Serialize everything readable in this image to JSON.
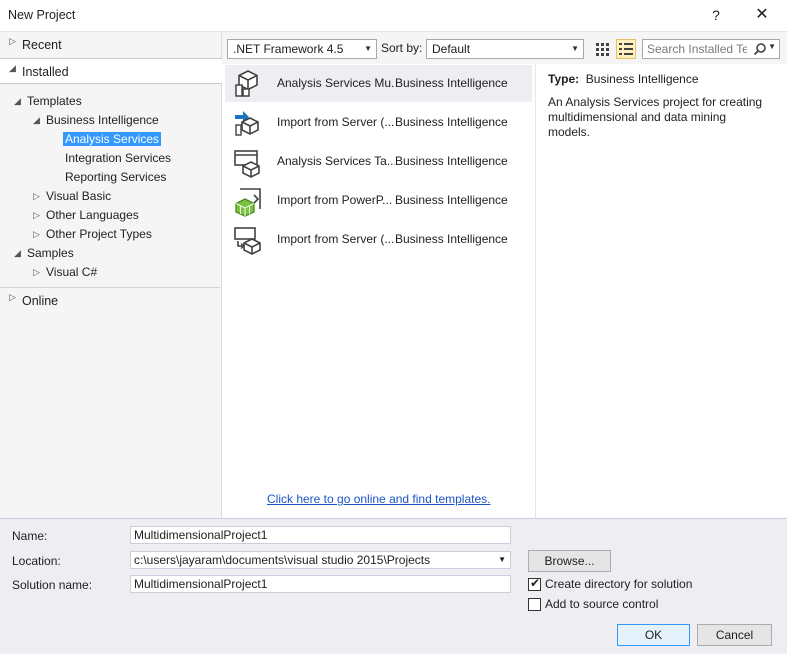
{
  "window": {
    "title": "New Project",
    "help": "?",
    "close": "✕"
  },
  "sidebar": {
    "recent": "Recent",
    "installed": "Installed",
    "templates": "Templates",
    "business_intelligence": "Business Intelligence",
    "analysis_services": "Analysis Services",
    "integration_services": "Integration Services",
    "reporting_services": "Reporting Services",
    "visual_basic": "Visual Basic",
    "other_languages": "Other Languages",
    "other_project_types": "Other Project Types",
    "samples": "Samples",
    "visual_csharp": "Visual C#",
    "online": "Online"
  },
  "toolbar": {
    "framework": ".NET Framework 4.5",
    "sort_by_label": "Sort by:",
    "sort_value": "Default",
    "search_placeholder": "Search Installed Ter"
  },
  "templates": [
    {
      "name": "Analysis Services Mu...",
      "type": "Business Intelligence",
      "icon": "analysis-services-multidimensional-icon"
    },
    {
      "name": "Import from Server (...",
      "type": "Business Intelligence",
      "icon": "import-from-server-icon"
    },
    {
      "name": "Analysis Services Ta...",
      "type": "Business Intelligence",
      "icon": "analysis-services-tabular-icon"
    },
    {
      "name": "Import from PowerP...",
      "type": "Business Intelligence",
      "icon": "import-from-powerpivot-icon"
    },
    {
      "name": "Import from Server (...",
      "type": "Business Intelligence",
      "icon": "import-from-server-tabular-icon"
    }
  ],
  "online_link": "Click here to go online and find templates.",
  "details": {
    "type_label": "Type:",
    "type_value": "Business Intelligence",
    "description": "An Analysis Services project for creating multidimensional and data mining models."
  },
  "form": {
    "name_label": "Name:",
    "name_value": "MultidimensionalProject1",
    "location_label": "Location:",
    "location_value": "c:\\users\\jayaram\\documents\\visual studio 2015\\Projects",
    "solution_label": "Solution name:",
    "solution_value": "MultidimensionalProject1",
    "browse": "Browse...",
    "create_dir": "Create directory for solution",
    "create_dir_checked": true,
    "add_source": "Add to source control",
    "add_source_checked": false,
    "ok": "OK",
    "cancel": "Cancel"
  },
  "colors": {
    "selection": "#3399ff",
    "link": "#1a55c5",
    "bottom_bg": "#eeeef2"
  }
}
